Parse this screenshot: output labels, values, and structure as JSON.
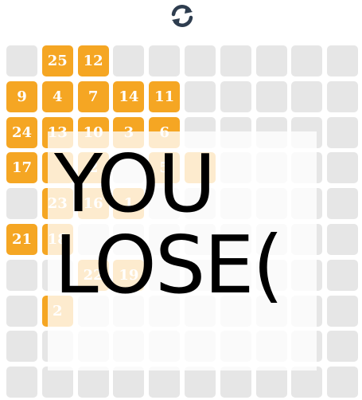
{
  "header": {
    "refresh_icon": "refresh-arrows-icon",
    "icon_color": "#2e3d4f"
  },
  "board": {
    "rows": 10,
    "cols": 10,
    "empty_color": "#e6e6e6",
    "filled_color": "#f5a623",
    "tiles": [
      {
        "row": 0,
        "col": 1,
        "value": "25"
      },
      {
        "row": 0,
        "col": 2,
        "value": "12"
      },
      {
        "row": 1,
        "col": 0,
        "value": "9"
      },
      {
        "row": 1,
        "col": 1,
        "value": "4"
      },
      {
        "row": 1,
        "col": 2,
        "value": "7"
      },
      {
        "row": 1,
        "col": 3,
        "value": "14"
      },
      {
        "row": 1,
        "col": 4,
        "value": "11"
      },
      {
        "row": 2,
        "col": 0,
        "value": "24"
      },
      {
        "row": 2,
        "col": 1,
        "value": "13"
      },
      {
        "row": 2,
        "col": 2,
        "value": "10"
      },
      {
        "row": 2,
        "col": 3,
        "value": "3"
      },
      {
        "row": 2,
        "col": 4,
        "value": "6"
      },
      {
        "row": 3,
        "col": 0,
        "value": "17"
      },
      {
        "row": 3,
        "col": 1,
        "value": ""
      },
      {
        "row": 3,
        "col": 2,
        "value": "2"
      },
      {
        "row": 3,
        "col": 4,
        "value": "5"
      },
      {
        "row": 3,
        "col": 5,
        "value": ""
      },
      {
        "row": 4,
        "col": 1,
        "value": "23"
      },
      {
        "row": 4,
        "col": 2,
        "value": "16"
      },
      {
        "row": 4,
        "col": 3,
        "value": "1"
      },
      {
        "row": 5,
        "col": 0,
        "value": "21"
      },
      {
        "row": 5,
        "col": 1,
        "value": "18"
      },
      {
        "row": 6,
        "col": 2,
        "value": "22"
      },
      {
        "row": 6,
        "col": 3,
        "value": "19"
      },
      {
        "row": 7,
        "col": 1,
        "value": "2"
      }
    ]
  },
  "overlay": {
    "message": "YOU\nLOSE("
  }
}
